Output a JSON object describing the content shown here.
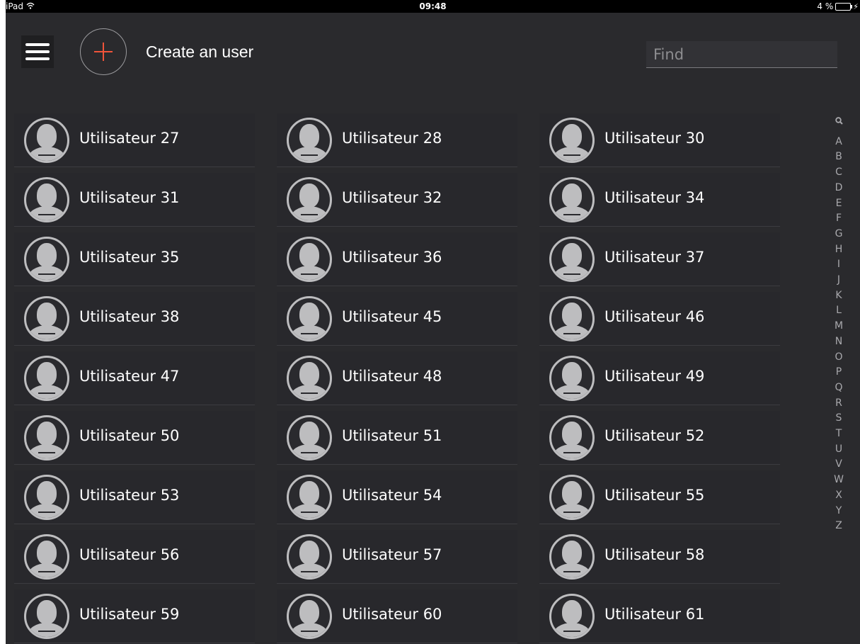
{
  "status_bar": {
    "device": "iPad",
    "time": "09:48",
    "battery": "4 %"
  },
  "header": {
    "create_label": "Create an user",
    "search_placeholder": "Find"
  },
  "users": [
    "Utilisateur 27",
    "Utilisateur 28",
    "Utilisateur 30",
    "Utilisateur 31",
    "Utilisateur 32",
    "Utilisateur 34",
    "Utilisateur 35",
    "Utilisateur 36",
    "Utilisateur 37",
    "Utilisateur 38",
    "Utilisateur 45",
    "Utilisateur 46",
    "Utilisateur 47",
    "Utilisateur 48",
    "Utilisateur 49",
    "Utilisateur 50",
    "Utilisateur 51",
    "Utilisateur 52",
    "Utilisateur 53",
    "Utilisateur 54",
    "Utilisateur 55",
    "Utilisateur 56",
    "Utilisateur 57",
    "Utilisateur 58",
    "Utilisateur 59",
    "Utilisateur 60",
    "Utilisateur 61"
  ],
  "alphabet": [
    "A",
    "B",
    "C",
    "D",
    "E",
    "F",
    "G",
    "H",
    "I",
    "J",
    "K",
    "L",
    "M",
    "N",
    "O",
    "P",
    "Q",
    "R",
    "S",
    "T",
    "U",
    "V",
    "W",
    "X",
    "Y",
    "Z"
  ],
  "icons": {
    "menu": "hamburger-menu-icon",
    "create": "plus-icon",
    "avatar": "user-avatar-icon",
    "index_search": "search-icon",
    "wifi": "wifi-icon",
    "battery": "battery-icon"
  },
  "colors": {
    "accent": "#f0543a",
    "background": "#2a2a2d",
    "text": "#ffffff"
  }
}
